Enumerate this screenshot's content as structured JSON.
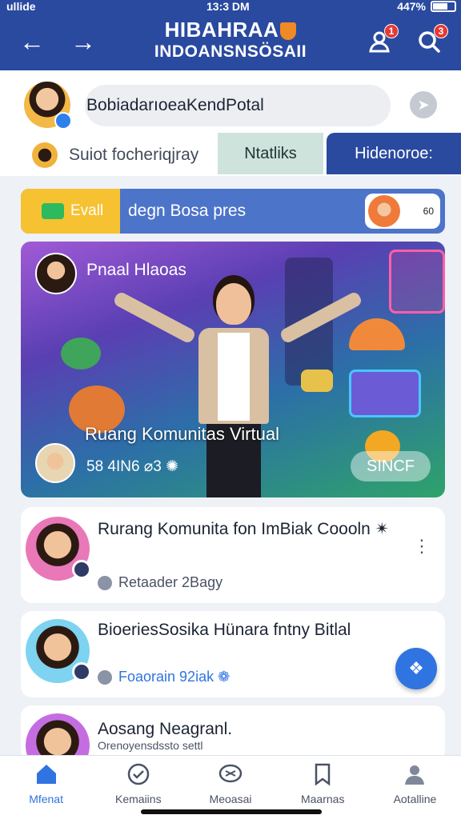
{
  "status_bar": {
    "carrier": "ullide",
    "time": "13:3 DM",
    "battery": "447%"
  },
  "header": {
    "title_line1": "HIBAHRAA",
    "title_line2": "INDOANSNSÖSAII",
    "notifications_badge": "1",
    "search_badge": "3"
  },
  "compose": {
    "placeholder": "BobiadarıoeaKendPotal",
    "sub_label": "Suiot focheriqjray",
    "tab_a": "Ntatliks",
    "tab_b": "Hidenoroe:"
  },
  "banner": {
    "left_label": "Evall",
    "text": "degn Bosa pres",
    "right_text": "60"
  },
  "hero": {
    "host_name": "Pnaal Hlaoas",
    "room_title": "Ruang Komunitas Virtual",
    "stats": "58 4IN6 ⌀3 ✺",
    "join_label": "SINCF"
  },
  "cards": [
    {
      "title": "Rurang Komunita fon ImBiak Coooln ✴",
      "meta": "Retaader 2Bagy"
    },
    {
      "title": "BioeriesSosika Hünara fntny Bitlal",
      "meta": "Foaorain 92iak ❁"
    },
    {
      "title": "Aosang Neagranl.",
      "meta": "Orenoyensdssto settl"
    }
  ],
  "bottom_nav": [
    {
      "label": "Mfenat",
      "icon": "home-icon"
    },
    {
      "label": "Kemaiins",
      "icon": "checkmark-circle-icon"
    },
    {
      "label": "Meoasai",
      "icon": "chat-icon"
    },
    {
      "label": "Maarnas",
      "icon": "bookmark-icon"
    },
    {
      "label": "Aotalline",
      "icon": "profile-icon"
    }
  ],
  "colors": {
    "header": "#2a4aa0",
    "accent": "#2f74e0",
    "banner_yellow": "#f6c232",
    "tab_active": "#2a4aa0"
  }
}
